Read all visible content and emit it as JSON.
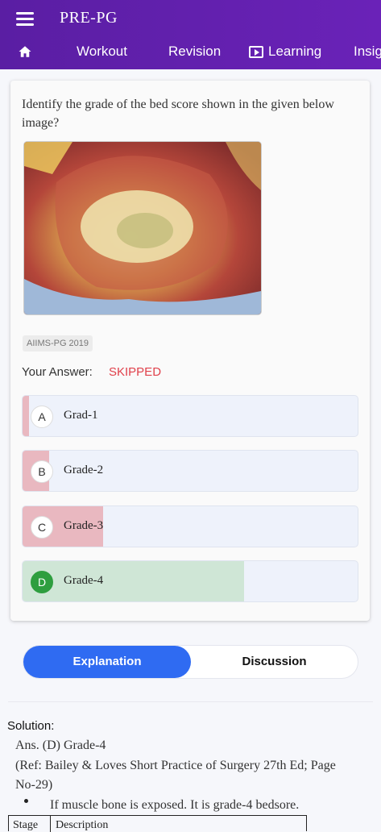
{
  "app": {
    "title": "PRE-PG"
  },
  "nav": {
    "tabs": [
      {
        "label": "Workout"
      },
      {
        "label": "Revision"
      },
      {
        "label": "Learning",
        "icon": "play-screen-icon"
      },
      {
        "label": "Insig"
      }
    ]
  },
  "question": {
    "text": "Identify the grade of the bed score shown in the given below image?",
    "image_icon": "wound-photo",
    "tag": "AIIMS-PG 2019",
    "answer_label": "Your Answer:",
    "answer_value": "SKIPPED",
    "options": [
      {
        "letter": "A",
        "text": "Grad-1",
        "percent": 2,
        "correct": false
      },
      {
        "letter": "B",
        "text": "Grade-2",
        "percent": 8,
        "correct": false
      },
      {
        "letter": "C",
        "text": "Grade-3",
        "percent": 24,
        "correct": false
      },
      {
        "letter": "D",
        "text": "Grade-4",
        "percent": 66,
        "correct": true
      }
    ]
  },
  "segment": {
    "active": "Explanation",
    "inactive": "Discussion"
  },
  "solution": {
    "heading": "Solution:",
    "ans": "Ans. (D) Grade-4",
    "ref_line1": "(Ref: Bailey & Loves Short Practice of Surgery 27th Ed; Page",
    "ref_line2": "No-29)",
    "bullet": "If muscle bone is exposed. It is grade-4 bedsore.",
    "table_col1": "Stage",
    "table_col2": "Description"
  },
  "colors": {
    "header": "#5a1ea3",
    "accent": "#2f6bf2",
    "wrong_fill": "#e9b8c0",
    "correct_fill": "#cfe6d6",
    "skipped": "#e0414b"
  }
}
